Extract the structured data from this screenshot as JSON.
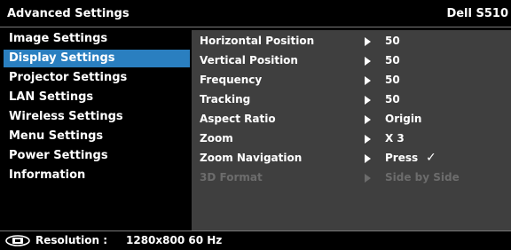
{
  "header": {
    "title": "Advanced Settings",
    "model": "Dell S510"
  },
  "sidebar": {
    "items": [
      {
        "label": "Image Settings",
        "selected": false
      },
      {
        "label": "Display Settings",
        "selected": true
      },
      {
        "label": "Projector Settings",
        "selected": false
      },
      {
        "label": "LAN Settings",
        "selected": false
      },
      {
        "label": "Wireless Settings",
        "selected": false
      },
      {
        "label": "Menu Settings",
        "selected": false
      },
      {
        "label": "Power Settings",
        "selected": false
      },
      {
        "label": "Information",
        "selected": false
      }
    ]
  },
  "panel": {
    "rows": [
      {
        "label": "Horizontal Position",
        "value": "50",
        "enabled": true
      },
      {
        "label": "Vertical Position",
        "value": "50",
        "enabled": true
      },
      {
        "label": "Frequency",
        "value": "50",
        "enabled": true
      },
      {
        "label": "Tracking",
        "value": "50",
        "enabled": true
      },
      {
        "label": "Aspect Ratio",
        "value": "Origin",
        "enabled": true
      },
      {
        "label": "Zoom",
        "value": "X 3",
        "enabled": true
      },
      {
        "label": "Zoom Navigation",
        "value": "Press",
        "check": "✓",
        "enabled": true
      },
      {
        "label": "3D Format",
        "value": "Side by Side",
        "enabled": false
      }
    ]
  },
  "status": {
    "icon": "display-resolution-icon",
    "label": "Resolution :",
    "value": "1280x800 60 Hz"
  },
  "colors": {
    "background": "#000000",
    "selected": "#2a7fc0",
    "panel": "#3f3f3f",
    "disabled_text": "#6c6c6c"
  }
}
